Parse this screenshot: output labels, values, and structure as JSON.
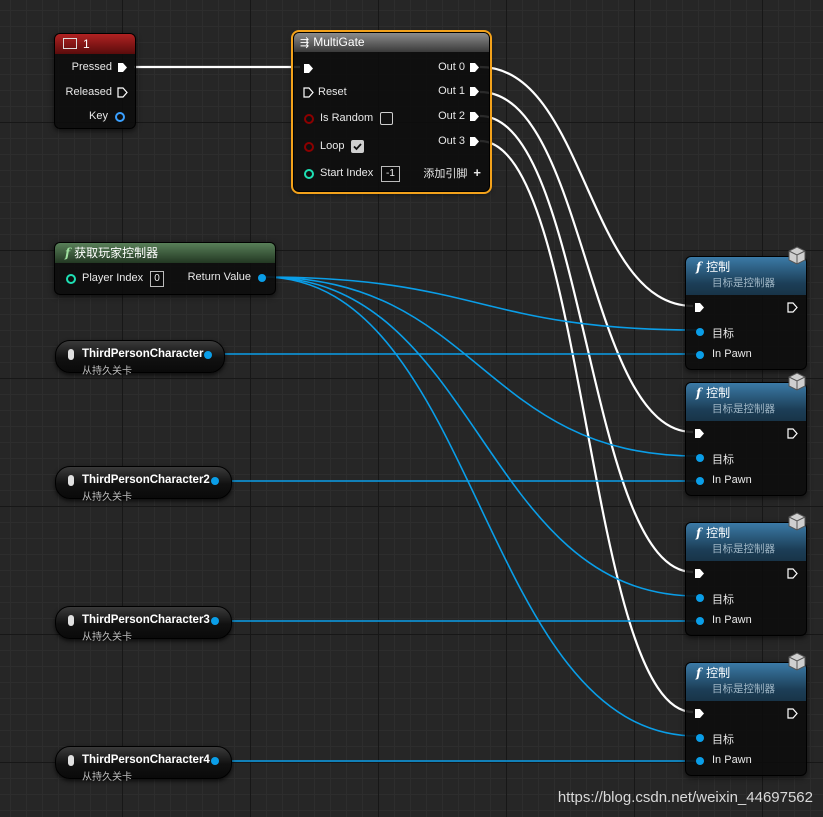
{
  "event_node": {
    "title": "1",
    "pins": [
      "Pressed",
      "Released",
      "Key"
    ]
  },
  "multigate": {
    "title": "MultiGate",
    "inputs": [
      "Reset",
      "Is Random",
      "Loop",
      "Start Index"
    ],
    "is_random_checked": false,
    "loop_checked": true,
    "start_index_value": "-1",
    "outputs": [
      "Out 0",
      "Out 1",
      "Out 2",
      "Out 3"
    ],
    "add_pin_label": "添加引脚"
  },
  "get_player_controller": {
    "title": "获取玩家控制器",
    "player_index_label": "Player Index",
    "player_index_value": "0",
    "return_value_label": "Return Value"
  },
  "variables": [
    {
      "name": "ThirdPersonCharacter",
      "sub": "从持久关卡"
    },
    {
      "name": "ThirdPersonCharacter2",
      "sub": "从持久关卡"
    },
    {
      "name": "ThirdPersonCharacter3",
      "sub": "从持久关卡"
    },
    {
      "name": "ThirdPersonCharacter4",
      "sub": "从持久关卡"
    }
  ],
  "possess_nodes": [
    {
      "title": "控制",
      "subtitle": "目标是控制器",
      "target_label": "目标",
      "pawn_label": "In Pawn"
    },
    {
      "title": "控制",
      "subtitle": "目标是控制器",
      "target_label": "目标",
      "pawn_label": "In Pawn"
    },
    {
      "title": "控制",
      "subtitle": "目标是控制器",
      "target_label": "目标",
      "pawn_label": "In Pawn"
    },
    {
      "title": "控制",
      "subtitle": "目标是控制器",
      "target_label": "目标",
      "pawn_label": "In Pawn"
    }
  ],
  "colors": {
    "exec_wire": "#ffffff",
    "object_wire": "#0a9ee8",
    "event_header": "#8a1414",
    "function_header": "#2f6a92",
    "pure_header": "#3f6b3f",
    "selection": "#f3a21b"
  },
  "watermark": "https://blog.csdn.net/weixin_44697562"
}
